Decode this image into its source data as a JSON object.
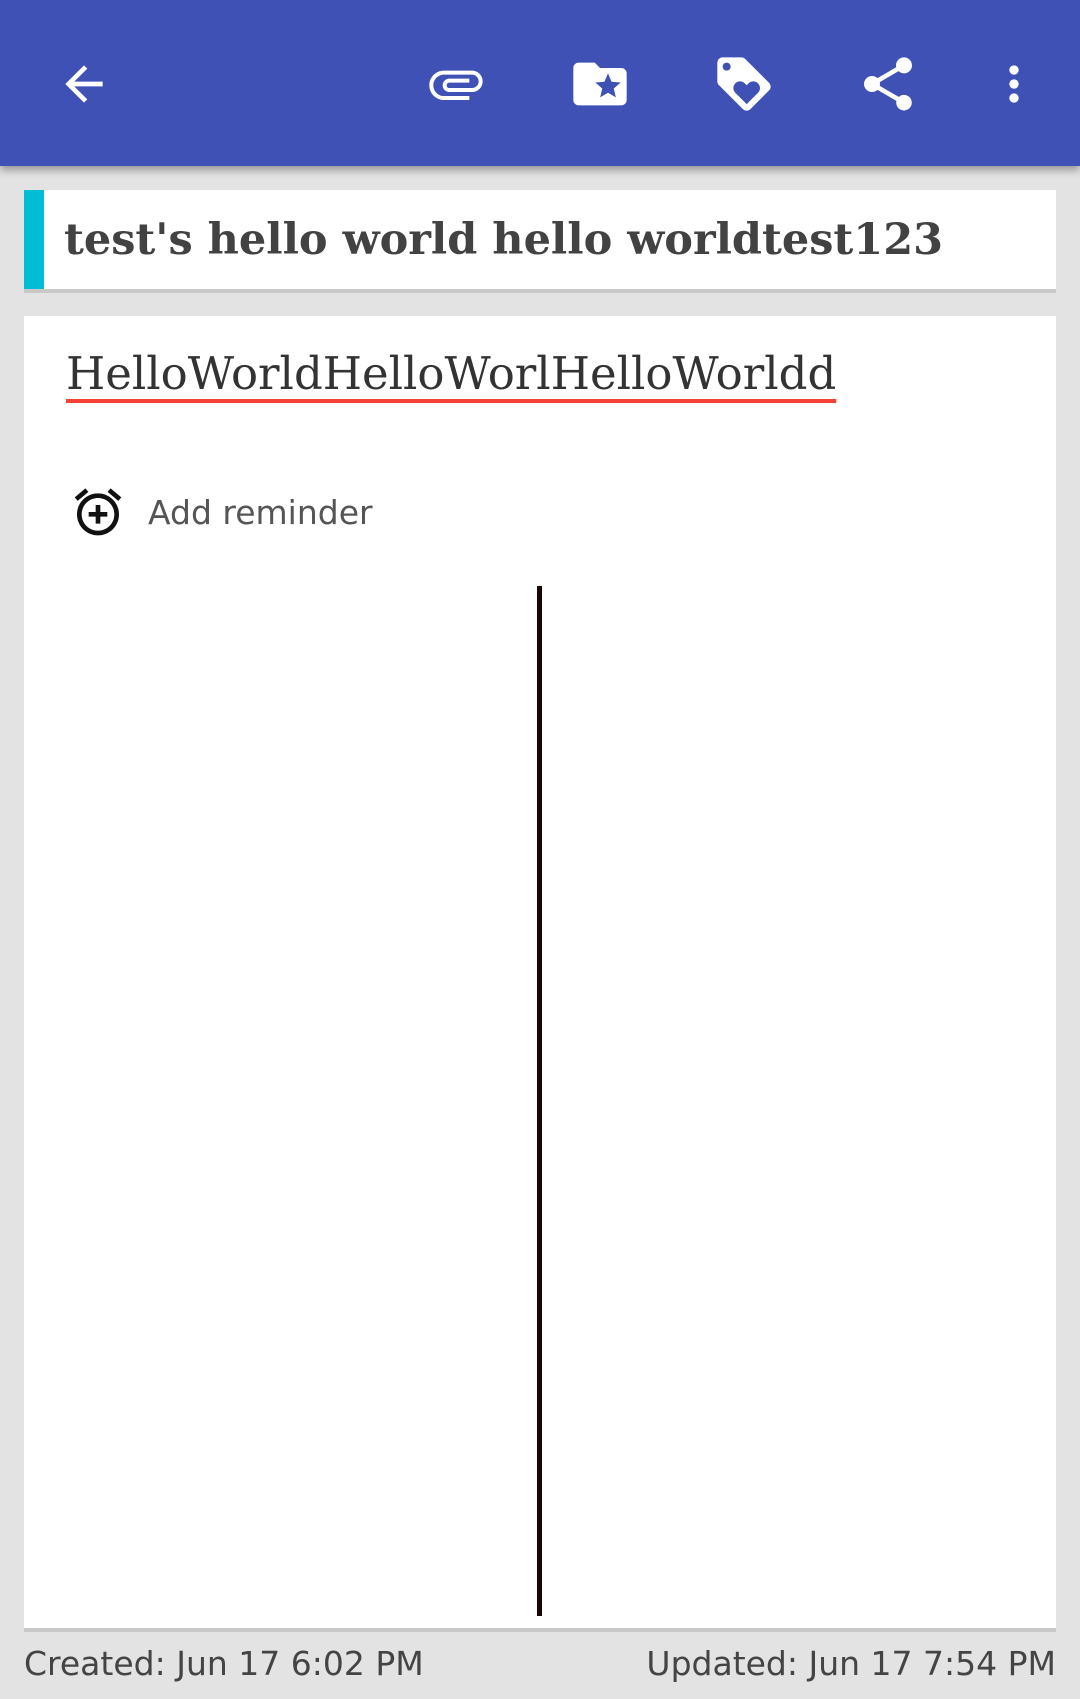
{
  "toolbar": {
    "background_color": "#3f51b5",
    "icons": [
      "arrow-back-icon",
      "attachment-icon",
      "folder-star-icon",
      "tag-heart-icon",
      "share-icon",
      "more-vert-icon"
    ]
  },
  "note": {
    "title": "test's hello world hello worldtest123",
    "category_color": "#00bcd4",
    "content": "HelloWorldHelloWorlHelloWorldd"
  },
  "reminder": {
    "label": "Add reminder"
  },
  "footer": {
    "created": "Created: Jun 17 6:02 PM",
    "updated": "Updated: Jun 17 7:54 PM"
  }
}
